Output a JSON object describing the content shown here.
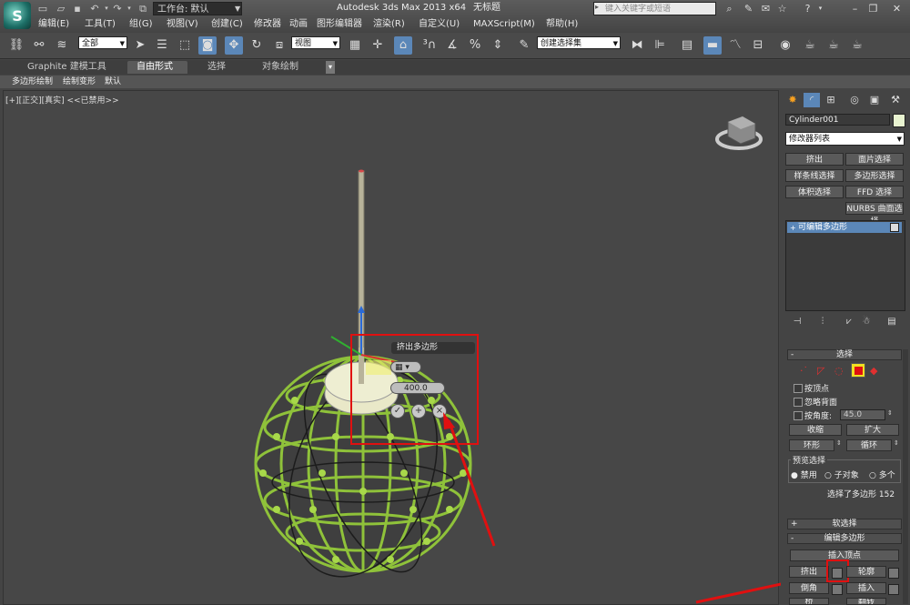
{
  "titlebar": {
    "workspace_label": "工作台: 默认",
    "app_title": "Autodesk 3ds Max  2013 x64",
    "document_name": "无标题",
    "search_placeholder": "键入关键字或短语",
    "menu": [
      "编辑(E)",
      "工具(T)",
      "组(G)",
      "视图(V)",
      "创建(C)",
      "修改器",
      "动画",
      "图形编辑器",
      "渲染(R)",
      "自定义(U)",
      "MAXScript(M)",
      "帮助(H)"
    ]
  },
  "toolbar": {
    "selection_filter": "全部",
    "reference_coord": "视图",
    "named_selection_set": "创建选择集"
  },
  "ribbon": {
    "tabs": [
      "Graphite 建模工具",
      "自由形式",
      "选择",
      "对象绘制"
    ],
    "subtabs": [
      "多边形绘制",
      "绘制变形",
      "默认"
    ]
  },
  "viewport": {
    "label": "[+][正交][真实] <<已禁用>>"
  },
  "caddy": {
    "title": "挤出多边形",
    "height_value": "400.0"
  },
  "command_panel": {
    "object_name": "Cylinder001",
    "modifier_list": "修改器列表",
    "modifier_buttons": [
      "挤出",
      "面片选择",
      "样条线选择",
      "多边形选择",
      "体积选择",
      "FFD 选择",
      "NURBS 曲面选择"
    ],
    "stack_item": "可编辑多边形",
    "selection_rollout": {
      "title": "选择",
      "by_vertex": "按顶点",
      "ignore_backfacing": "忽略背面",
      "by_angle": "按角度:",
      "angle_value": "45.0",
      "shrink": "收缩",
      "grow": "扩大",
      "ring": "环形",
      "loop": "循环",
      "preview_title": "预览选择",
      "preview_options": [
        "禁用",
        "子对象",
        "多个"
      ],
      "status": "选择了多边形 152"
    },
    "soft_selection_title": "软选择",
    "edit_poly_rollout": {
      "title": "编辑多边形",
      "insert_vertex": "插入顶点",
      "extrude": "挤出",
      "outline": "轮廓",
      "bevel": "倒角",
      "inset": "插入",
      "bridge": "桥",
      "flip": "翻转"
    }
  },
  "colors": {
    "selection_red": "#e01010",
    "mesh_green": "#8fc23a",
    "active_blue": "#5b87b8"
  }
}
